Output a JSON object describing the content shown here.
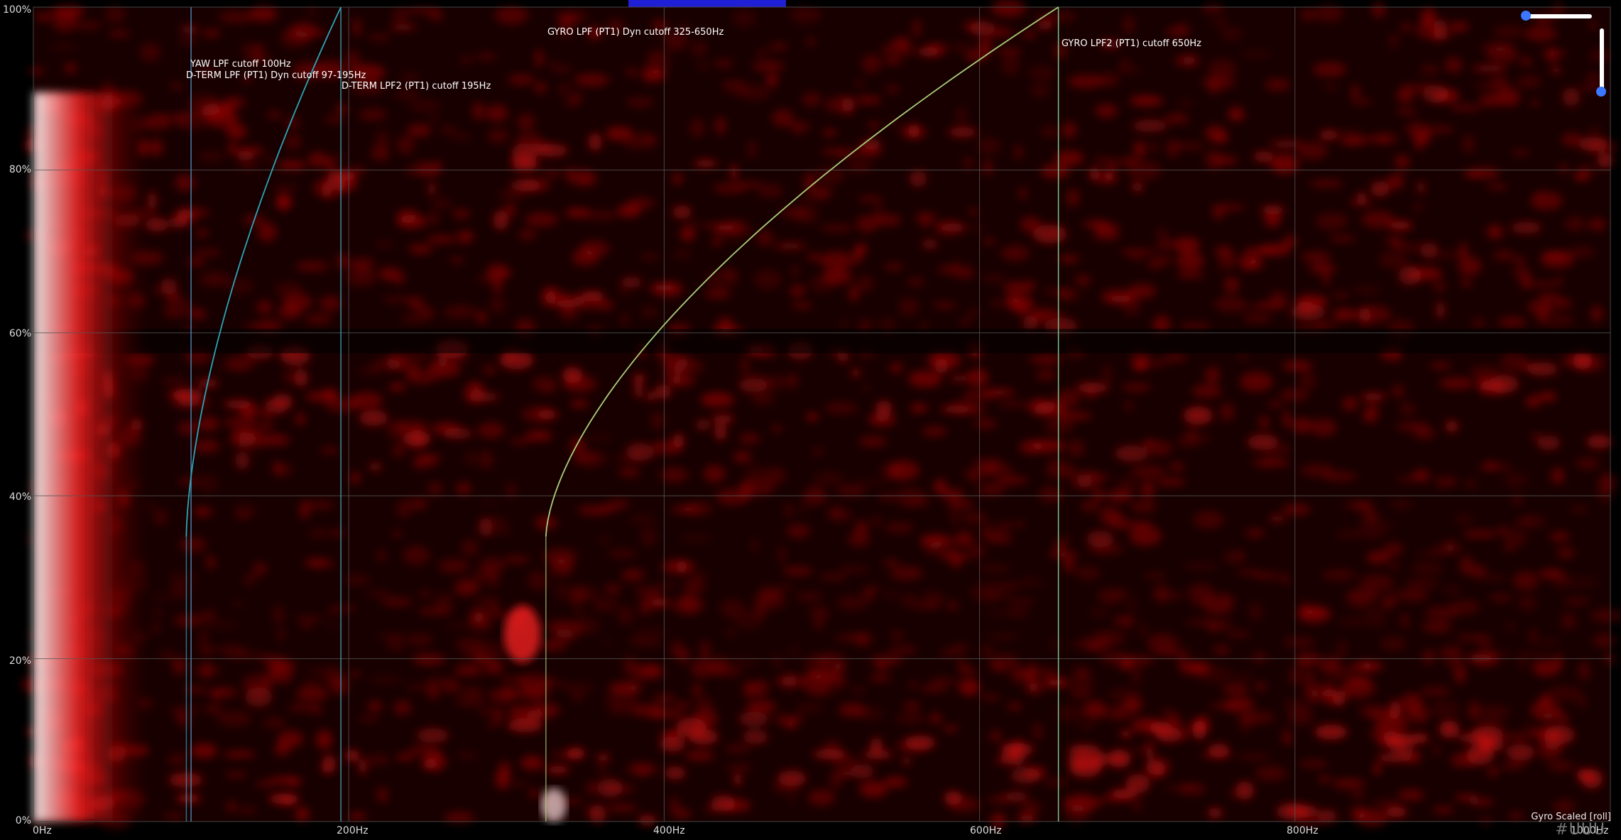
{
  "chart_data": {
    "type": "heatmap",
    "title": "",
    "xlabel": "",
    "ylabel": "",
    "xlim": [
      0,
      1000
    ],
    "ylim": [
      0,
      100
    ],
    "x_ticks": [
      "0Hz",
      "200Hz",
      "400Hz",
      "600Hz",
      "800Hz",
      "1000Hz"
    ],
    "x_tick_values": [
      0,
      200,
      400,
      600,
      800,
      1000
    ],
    "y_ticks": [
      "0%",
      "20%",
      "40%",
      "60%",
      "80%",
      "100%"
    ],
    "y_tick_values": [
      0,
      20,
      40,
      60,
      80,
      100
    ],
    "grid": true,
    "colors": {
      "heat": "#e00000",
      "hot": "#ffffff",
      "grid": "#555555",
      "dterm_line": "#2aa6b8",
      "gyro_line": "#a8d07a"
    },
    "filters": [
      {
        "label": "YAW LPF cutoff 100Hz",
        "kind": "static",
        "hz": 100,
        "color": "#4a7fa8"
      },
      {
        "label": "D-TERM LPF (PT1) Dyn cutoff 97-195Hz",
        "kind": "dynamic",
        "min_hz": 97,
        "max_hz": 195,
        "color": "#2aa6b8"
      },
      {
        "label": "D-TERM LPF2 (PT1) cutoff 195Hz",
        "kind": "static",
        "hz": 195,
        "color": "#3a8fa0"
      },
      {
        "label": "GYRO LPF (PT1) Dyn cutoff 325-650Hz",
        "kind": "dynamic",
        "min_hz": 325,
        "max_hz": 650,
        "color": "#a8d07a"
      },
      {
        "label": "GYRO LPF2 (PT1) cutoff 650Hz",
        "kind": "static",
        "hz": 650,
        "color": "#7cc090"
      }
    ],
    "dynamic_curve_start_throttle": 35,
    "dynamic_curve_end_throttle": 100,
    "series_label": "Gyro Scaled [roll]"
  },
  "overlay_tag": "#UUU"
}
